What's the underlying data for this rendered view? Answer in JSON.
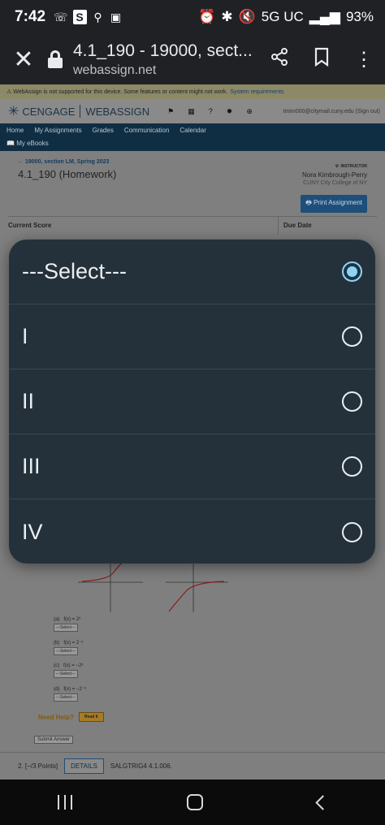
{
  "status_bar": {
    "time": "7:42",
    "network": "5G UC",
    "battery": "93%"
  },
  "browser": {
    "page_title": "4.1_190 - 19000, sect...",
    "domain": "webassign.net"
  },
  "page": {
    "warning": "WebAssign is not supported for this device. Some features or content might not work.",
    "warning_link": "System requirements",
    "brand_left": "CENGAGE",
    "brand_right": "WEBASSIGN",
    "email": "tmim000@citymail.cuny.edu",
    "sign_out": "(Sign out)",
    "nav": [
      "Home",
      "My Assignments",
      "Grades",
      "Communication",
      "Calendar"
    ],
    "my_ebooks": "My eBooks",
    "crumb": "19000, section LM, Spring 2023",
    "title": "4.1_190 (Homework)",
    "instructor_label": "INSTRUCTOR",
    "instructor_name": "Nora Kimbrough-Perry",
    "instructor_college": "CUNY City College of NY",
    "print_button": "Print Assignment",
    "current_score": "Current Score",
    "due_date": "Due Date",
    "questions": [
      {
        "label": "(a)",
        "func": "f(x) = 2ˣ",
        "select": "---Select---"
      },
      {
        "label": "(b)",
        "func": "f(x) = 2⁻ˣ",
        "select": "---Select---"
      },
      {
        "label": "(c)",
        "func": "f(x) = −2ˣ",
        "select": "---Select---"
      },
      {
        "label": "(d)",
        "func": "f(x) = −2⁻ˣ",
        "select": "---Select---"
      }
    ],
    "need_help": "Need Help?",
    "read_it": "Read It",
    "submit": "Submit Answer",
    "q2_points": "2. [−/3 Points]",
    "q2_details": "DETAILS",
    "q2_code": "SALGTRIG4 4.1.006."
  },
  "dialog": {
    "options": [
      {
        "label": "---Select---",
        "selected": true
      },
      {
        "label": "I",
        "selected": false
      },
      {
        "label": "II",
        "selected": false
      },
      {
        "label": "III",
        "selected": false
      },
      {
        "label": "IV",
        "selected": false
      }
    ]
  }
}
